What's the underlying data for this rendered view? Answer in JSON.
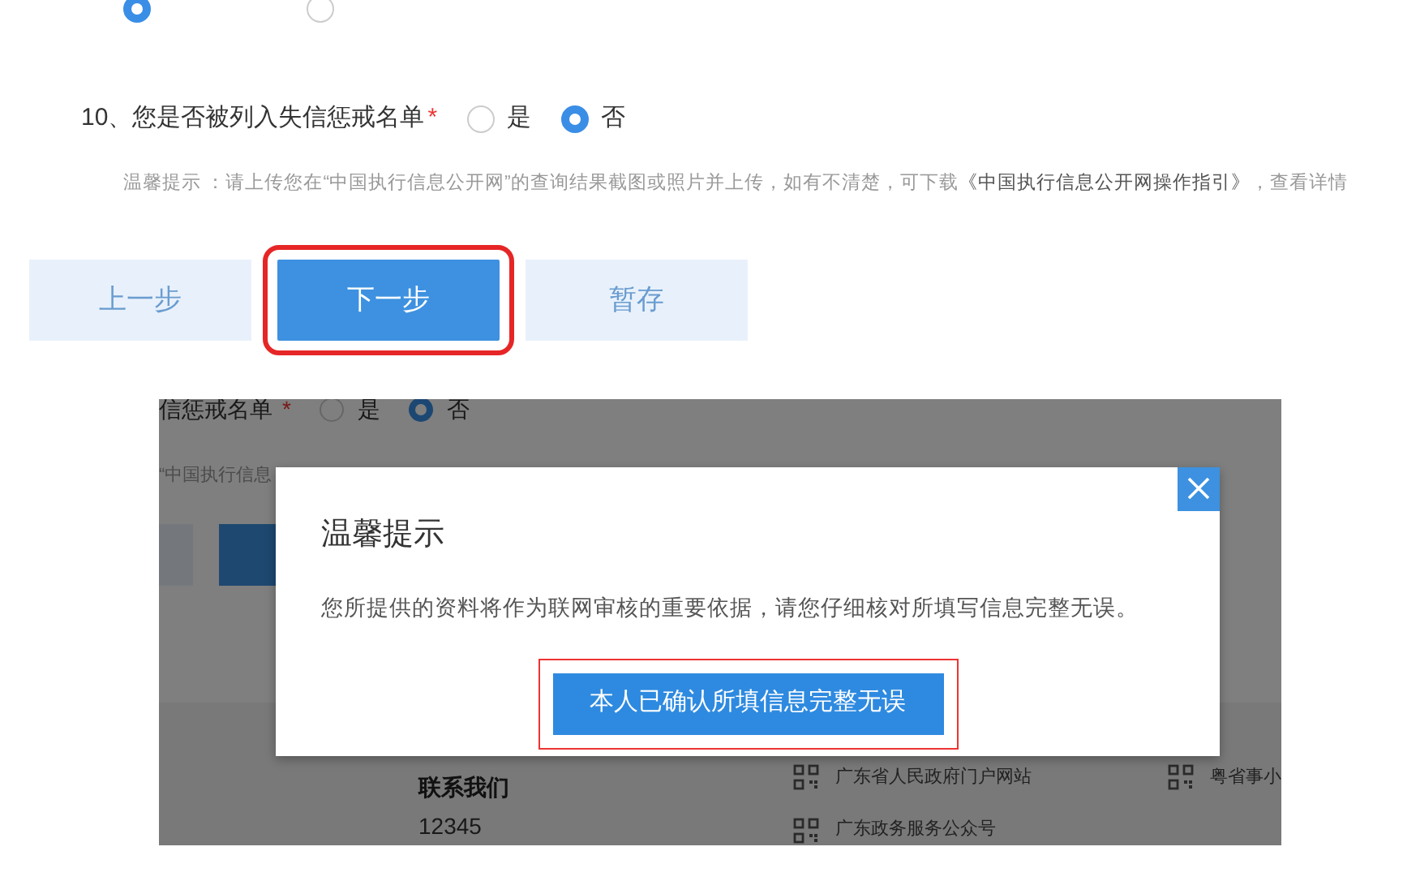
{
  "form": {
    "previous_question_options": [
      {
        "selected": true
      },
      {
        "selected": false
      }
    ],
    "question": {
      "number": "10、",
      "label": "您是否被列入失信惩戒名单",
      "required_mark": "*",
      "options": [
        {
          "label": "是",
          "selected": false
        },
        {
          "label": "否",
          "selected": true
        }
      ]
    },
    "hint": {
      "text": "温馨提示 ：请上传您在“中国执行信息公开网”的查询结果截图或照片并上传，如有不清楚，可下载",
      "link": "《中国执行信息公开网操作指引》",
      "tail": "，查看详情"
    },
    "buttons": [
      {
        "label": "上一步",
        "kind": "secondary",
        "highlighted": false
      },
      {
        "label": "下一步",
        "kind": "primary",
        "highlighted": true
      },
      {
        "label": "暂存",
        "kind": "secondary",
        "highlighted": false
      }
    ]
  },
  "inset": {
    "background": {
      "question_label": "信惩戒名单",
      "required_mark": "*",
      "options": [
        {
          "label": "是",
          "selected": false
        },
        {
          "label": "否",
          "selected": true
        }
      ],
      "hint_fragment": "“中国执行信息",
      "buttons": [
        {
          "kind": "secondary"
        },
        {
          "kind": "primary"
        }
      ],
      "footer": {
        "heading": "联系我们",
        "phone": "12345",
        "links": [
          "广东省人民政府门户网站",
          "广东政务服务公众号"
        ],
        "side_link": "粤省事小"
      }
    },
    "dialog": {
      "title": "温馨提示",
      "message": "您所提供的资料将作为联网审核的重要依据，请您仔细核对所填写信息完整无误。",
      "confirm": {
        "label": "本人已确认所填信息完整无误",
        "highlighted": true
      }
    }
  }
}
